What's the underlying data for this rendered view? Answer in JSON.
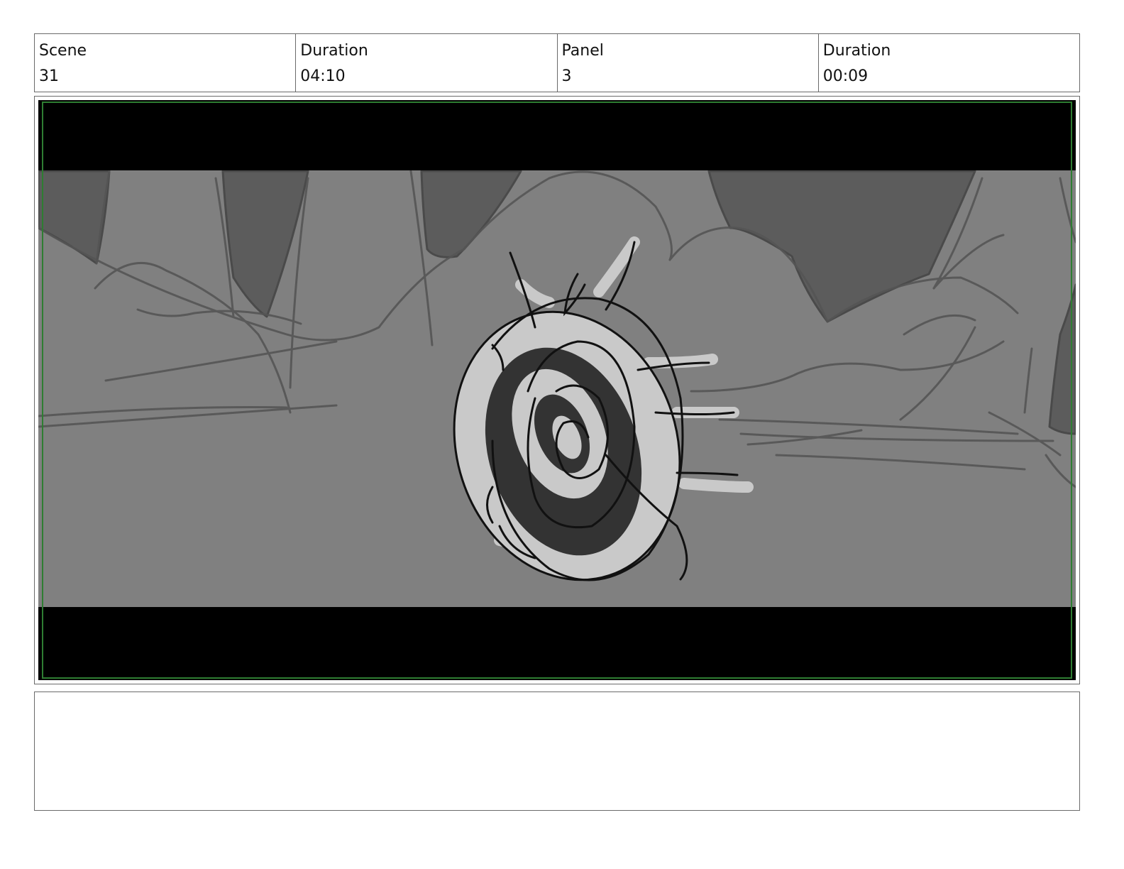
{
  "header": {
    "scene_label": "Scene",
    "scene_value": "31",
    "scene_duration_label": "Duration",
    "scene_duration_value": "04:10",
    "panel_label": "Panel",
    "panel_value": "3",
    "panel_duration_label": "Duration",
    "panel_duration_value": "00:09"
  },
  "panel": {
    "description": "",
    "colors": {
      "letterbox": "#000000",
      "background": "#808080",
      "shadow": "#5c5c5c",
      "light": "#c9c9c9",
      "dark": "#333333",
      "safe_area": "#2e7d32"
    }
  },
  "notes": {
    "text": ""
  }
}
